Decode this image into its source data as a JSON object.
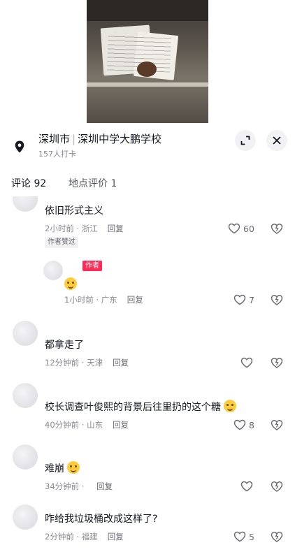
{
  "location": {
    "city": "深圳市",
    "place": "深圳中学大鹏学校",
    "checkins": "157人打卡"
  },
  "tabs": [
    {
      "label": "评论 92",
      "active": true
    },
    {
      "label": "地点评价 1",
      "active": false
    }
  ],
  "comments": [
    {
      "text": "依旧形式主义",
      "time": "2小时前",
      "region": "浙江",
      "reply": "回复",
      "likes": "60",
      "tag": "作者赞过"
    },
    {
      "text": "",
      "emoji": "smirk-emoji",
      "badge": "作者",
      "time": "1小时前",
      "region": "广东",
      "reply": "回复",
      "likes": "7"
    },
    {
      "text": "都拿走了",
      "time": "12分钟前",
      "region": "天津",
      "reply": "回复",
      "likes": ""
    },
    {
      "text": "校长调查叶俊熙的背景后往里扔的这个糖",
      "emoji": "laughing-crying-emoji",
      "time": "40分钟前",
      "region": "山东",
      "reply": "回复",
      "likes": "8"
    },
    {
      "text": "难崩",
      "emoji": "laughing-crying-emoji",
      "time": "34分钟前",
      "region": "",
      "reply": "回复",
      "likes": ""
    },
    {
      "text": "咋给我垃圾桶改成这样了?",
      "time": "2分钟前",
      "region": "福建",
      "reply": "回复",
      "likes": "5"
    }
  ],
  "colors": {
    "accent": "#fe2c55",
    "text": "#161823",
    "meta": "#8a8b91"
  }
}
